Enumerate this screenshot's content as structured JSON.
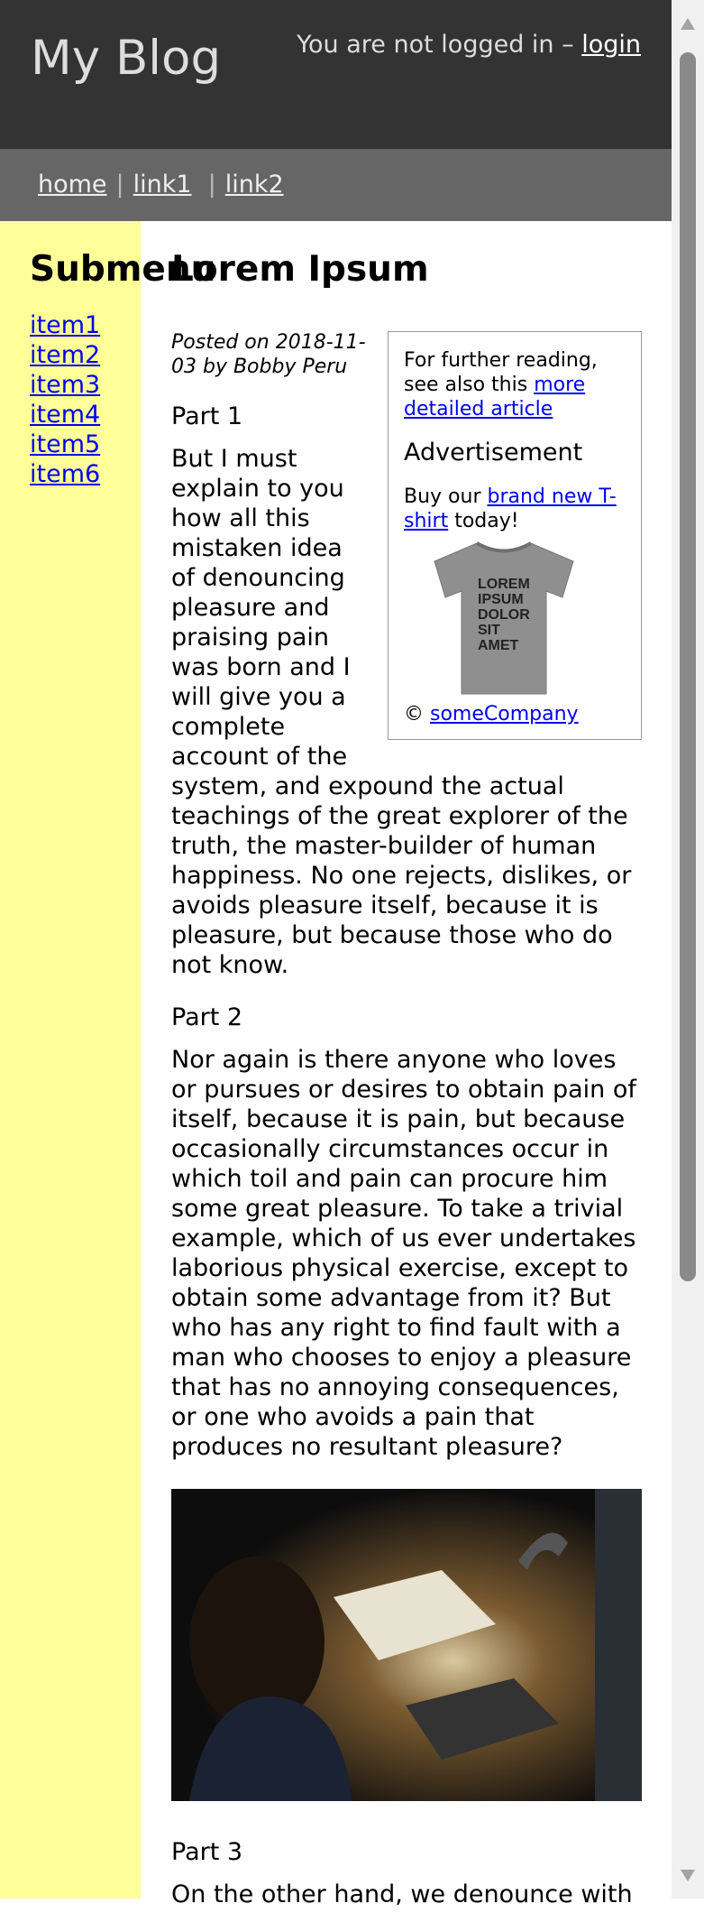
{
  "header": {
    "site_title": "My Blog",
    "login_text": "You are not logged in –",
    "login_link": "login"
  },
  "nav": {
    "home": "home",
    "link1": "link1",
    "link2": "link2",
    "separator": "|"
  },
  "sidebar": {
    "title": "Submenu",
    "items": [
      {
        "label": "item1"
      },
      {
        "label": "item2"
      },
      {
        "label": "item3"
      },
      {
        "label": "item4"
      },
      {
        "label": "item5"
      },
      {
        "label": "item6"
      }
    ]
  },
  "article": {
    "title": "Lorem Ipsum",
    "byline": "Posted on 2018-11-03 by Bobby Peru",
    "part1_heading": "Part 1",
    "part1_text": "But I must explain to you how all this mistaken idea of denouncing pleasure and praising pain was born and I will give you a complete account of the system, and expound the actual teachings of the great explorer of the truth, the master-builder of human happiness. No one rejects, dislikes, or avoids pleasure itself, because it is pleasure, but because those who do not know.",
    "part2_heading": "Part 2",
    "part2_text": "Nor again is there anyone who loves or pursues or desires to obtain pain of itself, because it is pain, but because occasionally circumstances occur in which toil and pain can procure him some great pleasure. To take a trivial example, which of us ever undertakes laborious physical exercise, except to obtain some advantage from it? But who has any right to find fault with a man who chooses to enjoy a pleasure that has no annoying consequences, or one who avoids a pain that produces no resultant pleasure?",
    "part3_heading": "Part 3",
    "part3_text": "On the other hand, we denounce with"
  },
  "aside": {
    "reading_prefix": "For further reading, see also this",
    "reading_link": "more detailed article",
    "ad_heading": "Advertisement",
    "ad_prefix": "Buy our",
    "ad_link": "brand new T-shirt",
    "ad_suffix": "today!",
    "tshirt_text": [
      "LOREM",
      "IPSUM",
      "DOLOR",
      "SIT",
      "AMET"
    ],
    "copyright_symbol": "©",
    "copyright_link": "someCompany"
  },
  "colors": {
    "header_bg": "#333333",
    "nav_bg": "#666666",
    "sidebar_bg": "#ffff99",
    "link": "#0000ee"
  }
}
